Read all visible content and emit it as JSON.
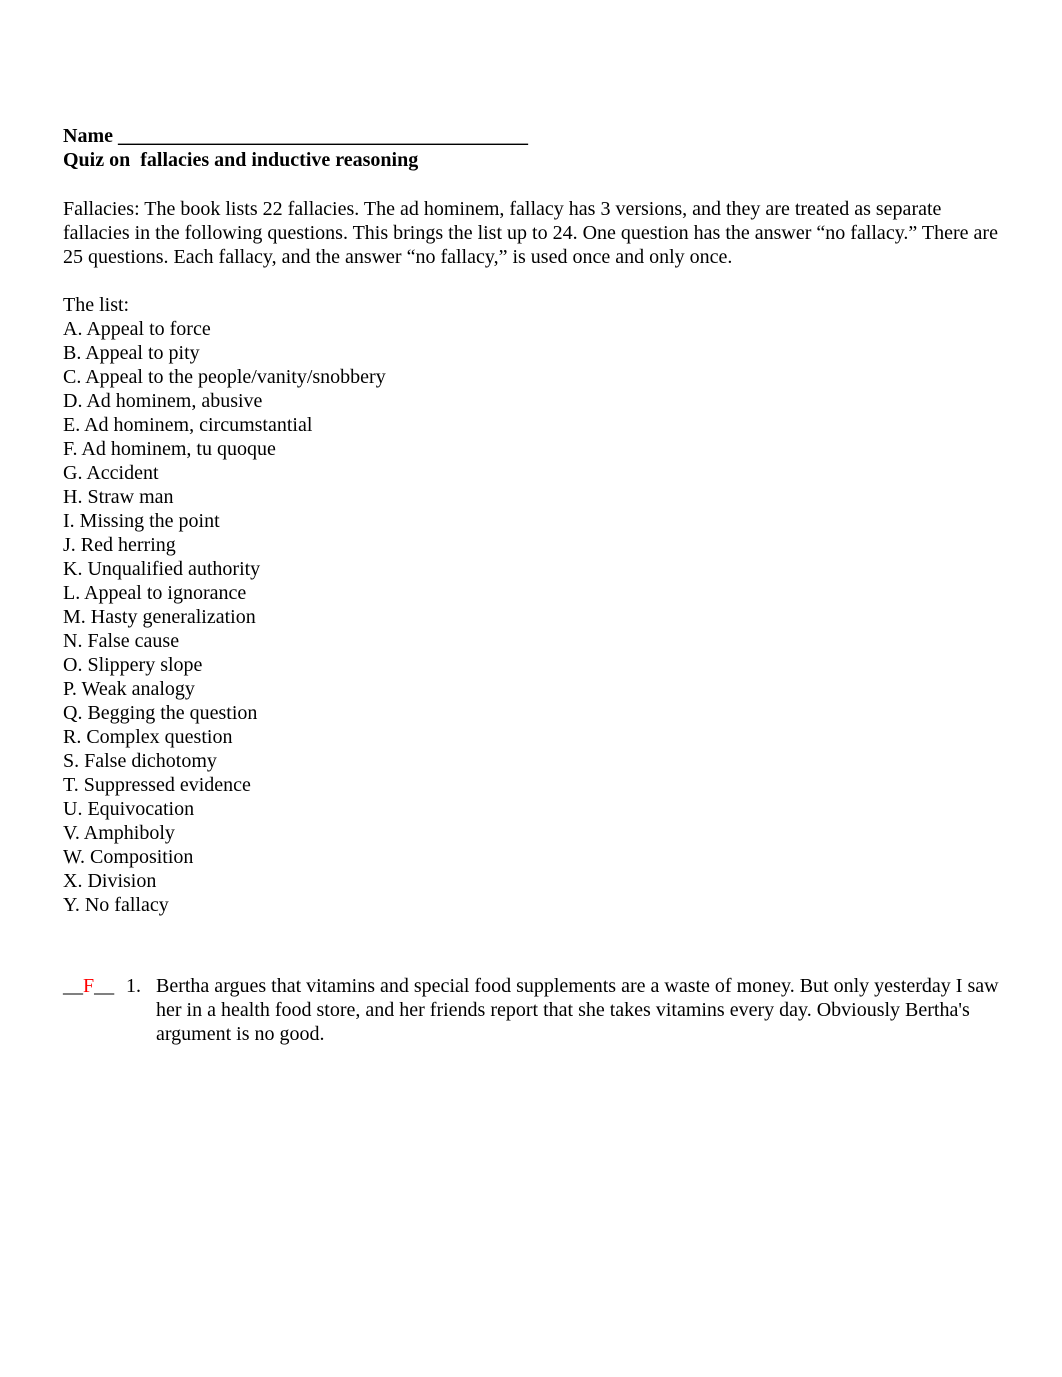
{
  "header": {
    "name_label": "Name ",
    "name_blank": "_________________________________________",
    "title": "Quiz on  fallacies and inductive reasoning"
  },
  "intro": "Fallacies: The book lists 22 fallacies. The ad hominem, fallacy has 3 versions, and they are treated as separate fallacies in the following questions. This brings the list up to 24.  One question has the answer “no fallacy.” There are 25 questions. Each fallacy, and the answer “no fallacy,” is used once and only once.",
  "list": {
    "label": "The list:",
    "items": [
      "A. Appeal to force",
      "B. Appeal to pity",
      "C. Appeal to the people/vanity/snobbery",
      "D. Ad hominem, abusive",
      "E. Ad hominem, circumstantial",
      "F. Ad hominem, tu quoque",
      "G. Accident",
      "H. Straw man",
      "I. Missing the point",
      "J. Red herring",
      "K. Unqualified authority",
      "L. Appeal to ignorance",
      "M. Hasty generalization",
      "N. False cause",
      "O. Slippery slope",
      "P. Weak analogy",
      "Q. Begging the question",
      "R. Complex question",
      "S. False dichotomy",
      "T. Suppressed evidence",
      "U. Equivocation",
      "V. Amphiboly",
      "W. Composition",
      "X. Division",
      "Y. No fallacy"
    ]
  },
  "questions": [
    {
      "blank_left": "__",
      "answer": "F",
      "blank_right": "__",
      "number": "1.",
      "text": "Bertha argues that vitamins and special food supplements are a waste of money. But only yesterday I saw her in a health food store, and her friends report that she takes vitamins every day. Obviously Bertha's argument is no good.",
      "answer_color": "#ff0000"
    }
  ]
}
